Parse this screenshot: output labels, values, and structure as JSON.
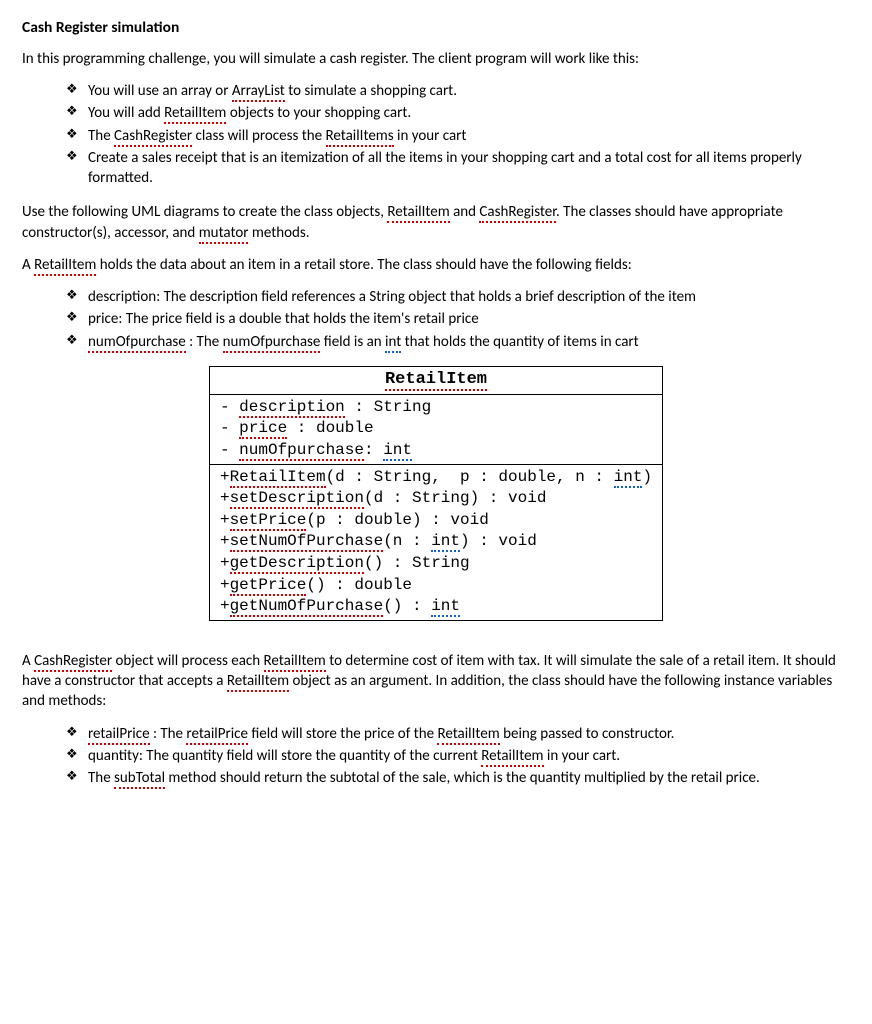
{
  "title": "Cash Register simulation",
  "intro_p1": "In this programming challenge, you will simulate a cash register.  The client program will work like this:",
  "bullets1": {
    "b1_a": "You will use an array or ",
    "b1_s1": "ArrayList",
    "b1_b": " to simulate a shopping cart.",
    "b2_a": "You will add ",
    "b2_s1": "RetailItem",
    "b2_b": " objects to your shopping cart.",
    "b3_a": "The ",
    "b3_s1": "CashRegister",
    "b3_b": " class will process the ",
    "b3_s2": "RetailItems",
    "b3_c": " in your cart",
    "b4": "Create a sales receipt that is an itemization of all the items in your shopping cart and a total cost for all items properly formatted."
  },
  "p2_a": "Use the following UML diagrams to create the class objects, ",
  "p2_s1": "RetailItem",
  "p2_b": " and ",
  "p2_s2": "CashRegister",
  "p2_c": ".  The classes should have appropriate constructor(s), accessor, and ",
  "p2_s3": "mutator",
  "p2_d": " methods.",
  "p3_a": "A ",
  "p3_s1": "RetailItem",
  "p3_b": " holds the data about an item in a retail store.  The class should have the following fields:",
  "bullets2": {
    "b1": "description: The description field references a String object that holds a brief description of the item",
    "b2": "price: The price field is a double that holds the item's retail price",
    "b3_s1": "numOfpurchase",
    "b3_a": " : The ",
    "b3_s2": "numOfpurchase",
    "b3_b": " field is an ",
    "b3_s3": "int",
    "b3_c": " that holds the quantity of items in cart"
  },
  "uml": {
    "class_name": "RetailItem",
    "attrs": {
      "a1_pre": "- ",
      "a1_s": "description",
      "a1_post": " : String",
      "a2_pre": "- ",
      "a2_s": "price",
      "a2_post": " : double",
      "a3_pre": "- ",
      "a3_s": "numOfpurchase",
      "a3_post": ": ",
      "a3_s2": "int"
    },
    "methods": {
      "m1_pre": "+",
      "m1_s1": "RetailItem",
      "m1_a": "(d : String,  p : double, n : ",
      "m1_s2": "int",
      "m1_b": ")",
      "m2_pre": "+",
      "m2_s1": "setDescription",
      "m2_a": "(d : String) : void",
      "m3_pre": "+",
      "m3_s1": "setPrice",
      "m3_a": "(p : double) : void",
      "m4_pre": "+",
      "m4_s1": "setNumOfPurchase",
      "m4_a": "(n : ",
      "m4_s2": "int",
      "m4_b": ") : void",
      "m5_pre": "+",
      "m5_s1": "getDescription",
      "m5_a": "() : String",
      "m6_pre": "+",
      "m6_s1": "getPrice",
      "m6_a": "() : double",
      "m7_pre": "+",
      "m7_s1": "getNumOfPurchase",
      "m7_a": "() : ",
      "m7_s2": "int"
    }
  },
  "p4_a": "A ",
  "p4_s1": "CashRegister",
  "p4_b": " object will process each ",
  "p4_s2": "RetailItem",
  "p4_c": " to determine cost of item with tax.  It will simulate the sale of a retail item.  It should have a constructor that accepts a ",
  "p4_s3": "RetailItem",
  "p4_d": " object as an argument.  In addition, the class should have the following instance variables and methods:",
  "bullets3": {
    "b1_s1": "retailPrice",
    "b1_a": " : The ",
    "b1_s2": "retailPrice",
    "b1_b": " field will store the price of the ",
    "b1_s3": "RetailItem",
    "b1_c": " being passed to constructor.",
    "b2_a": "quantity: The quantity field will store the quantity of the current ",
    "b2_s1": "RetailItem",
    "b2_b": " in your cart.",
    "b3_a": "The ",
    "b3_s1": "subTotal",
    "b3_b": " method should return the subtotal of the sale, which is the quantity multiplied by the retail price."
  }
}
